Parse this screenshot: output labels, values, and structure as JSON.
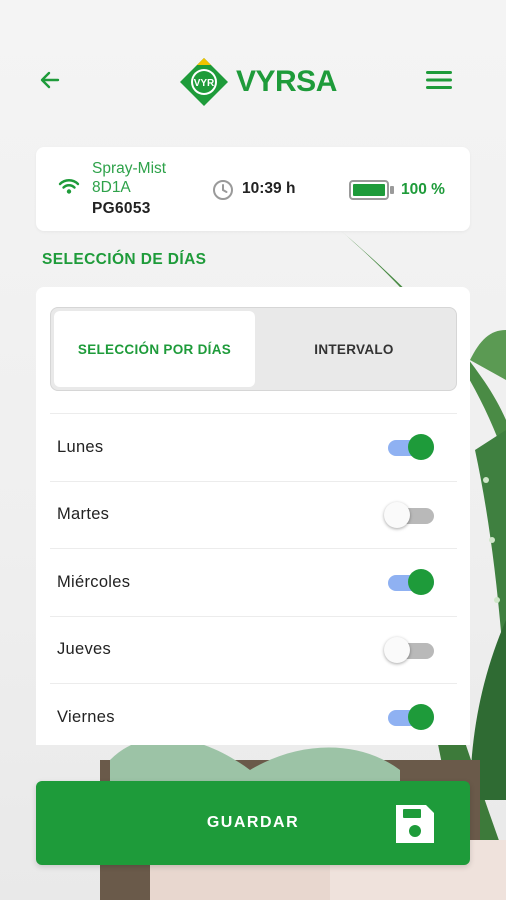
{
  "brand": {
    "name": "VYRSA",
    "badge": "VYR",
    "color": "#1e9b3a"
  },
  "header": {
    "back_icon": "arrow-left-icon",
    "menu_icon": "hamburger-menu-icon"
  },
  "device": {
    "name": "Spray-Mist 8D1A",
    "id": "PG6053",
    "time": "10:39 h",
    "battery_percent": "100 %",
    "battery_level": 1.0,
    "signal_icon": "wifi-icon",
    "clock_icon": "clock-icon"
  },
  "section_title": "SELECCIÓN DE DÍAS",
  "tabs": [
    {
      "label": "SELECCIÓN POR DÍAS",
      "active": true
    },
    {
      "label": "INTERVALO",
      "active": false
    }
  ],
  "days": [
    {
      "label": "Lunes",
      "enabled": true
    },
    {
      "label": "Martes",
      "enabled": false
    },
    {
      "label": "Miércoles",
      "enabled": true
    },
    {
      "label": "Jueves",
      "enabled": false
    },
    {
      "label": "Viernes",
      "enabled": true
    }
  ],
  "save": {
    "label": "GUARDAR",
    "icon": "floppy-disk-icon"
  },
  "colors": {
    "accent": "#1e9b3a",
    "toggle_track_on": "#8fb1f2",
    "toggle_track_off": "#b9b9b9"
  }
}
